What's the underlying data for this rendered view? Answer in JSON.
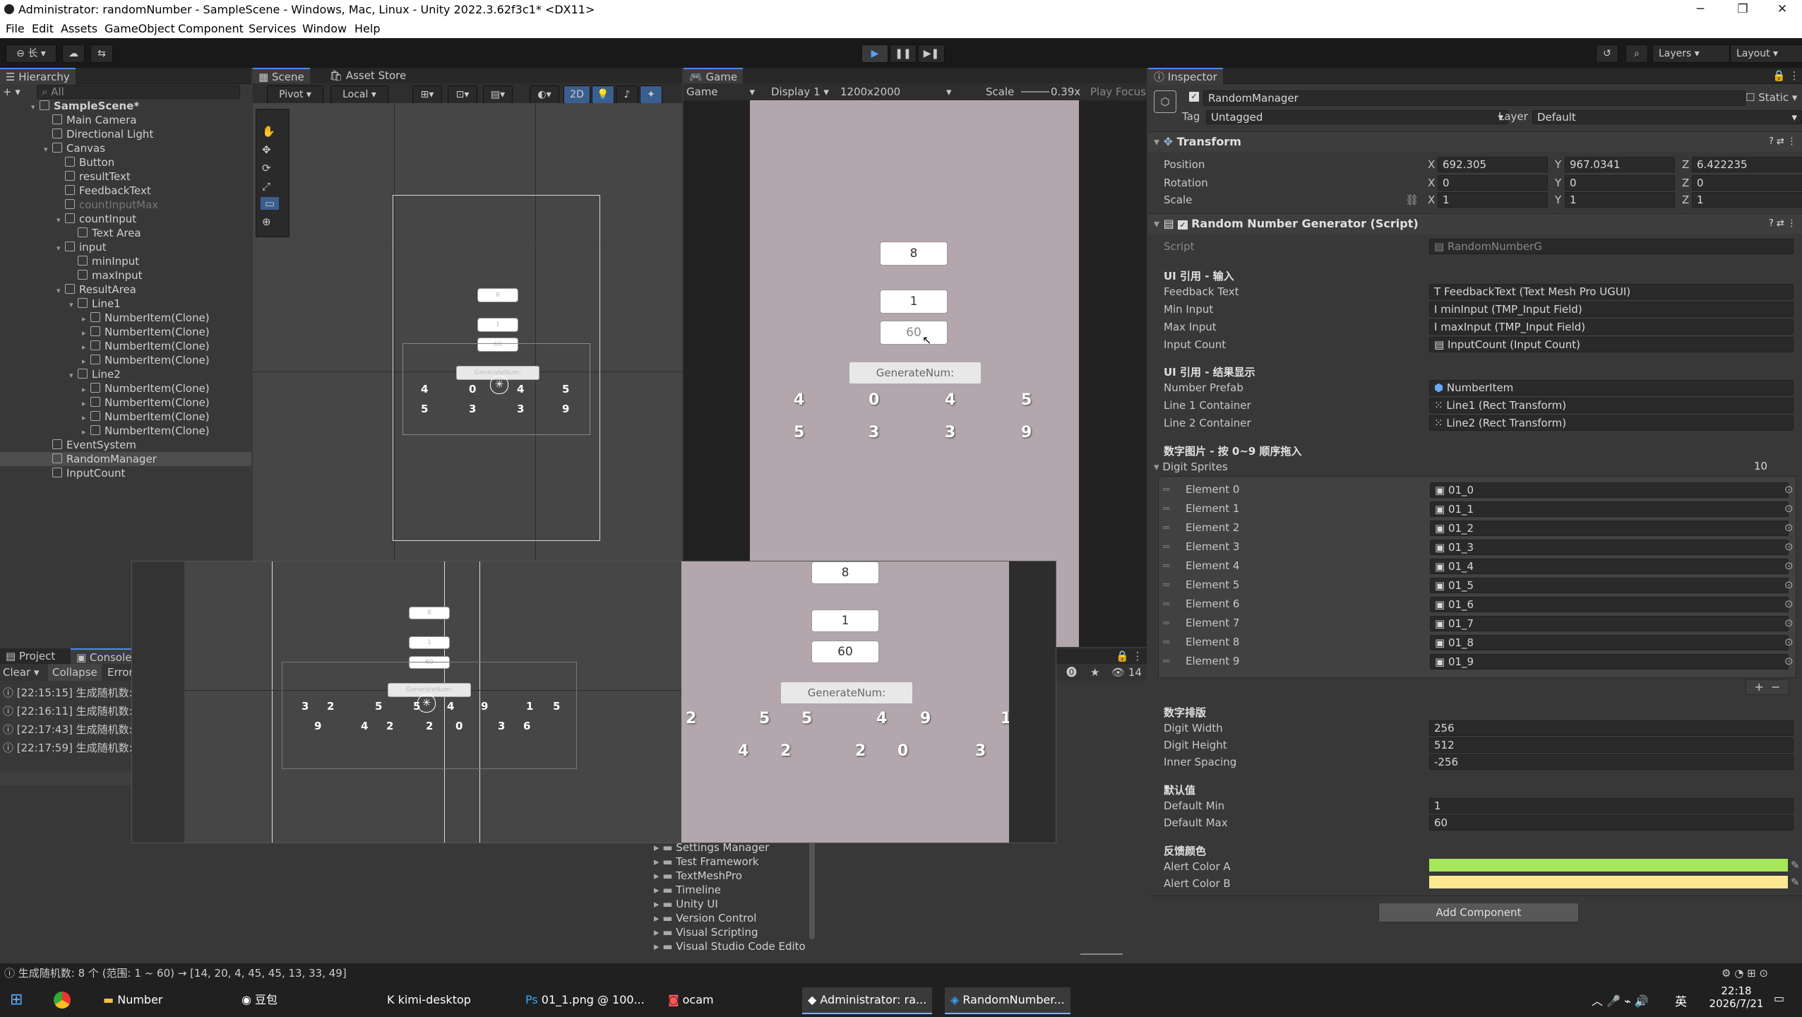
{
  "window": {
    "title": "Administrator: randomNumber - SampleScene - Windows, Mac, Linux - Unity 2022.3.62f3c1* <DX11>"
  },
  "menu": [
    "File",
    "Edit",
    "Assets",
    "GameObject",
    "Component",
    "Services",
    "Window",
    "Help"
  ],
  "toolbar": {
    "layers": "Layers",
    "layout": "Layout"
  },
  "hierarchy": {
    "tab": "Hierarchy",
    "search": "All",
    "items": [
      {
        "label": "SampleScene*",
        "depth": 0
      },
      {
        "label": "Main Camera",
        "depth": 1
      },
      {
        "label": "Directional Light",
        "depth": 1
      },
      {
        "label": "Canvas",
        "depth": 1
      },
      {
        "label": "Button",
        "depth": 2
      },
      {
        "label": "resultText",
        "depth": 2
      },
      {
        "label": "FeedbackText",
        "depth": 2
      },
      {
        "label": "countInputMax",
        "depth": 2
      },
      {
        "label": "countInput",
        "depth": 2
      },
      {
        "label": "Text Area",
        "depth": 3
      },
      {
        "label": "input",
        "depth": 2
      },
      {
        "label": "minInput",
        "depth": 3
      },
      {
        "label": "maxInput",
        "depth": 3
      },
      {
        "label": "ResultArea",
        "depth": 2
      },
      {
        "label": "Line1",
        "depth": 3
      },
      {
        "label": "NumberItem(Clone)",
        "depth": 4
      },
      {
        "label": "NumberItem(Clone)",
        "depth": 4
      },
      {
        "label": "NumberItem(Clone)",
        "depth": 4
      },
      {
        "label": "NumberItem(Clone)",
        "depth": 4
      },
      {
        "label": "Line2",
        "depth": 3
      },
      {
        "label": "NumberItem(Clone)",
        "depth": 4
      },
      {
        "label": "NumberItem(Clone)",
        "depth": 4
      },
      {
        "label": "NumberItem(Clone)",
        "depth": 4
      },
      {
        "label": "NumberItem(Clone)",
        "depth": 4
      },
      {
        "label": "EventSystem",
        "depth": 1
      },
      {
        "label": "RandomManager",
        "depth": 1
      },
      {
        "label": "InputCount",
        "depth": 1
      }
    ]
  },
  "scene": {
    "tab1": "Scene",
    "tab2": "Asset Store",
    "pivot": "Pivot",
    "local": "Local",
    "mode2d": "2D",
    "labels": [
      "8",
      "1",
      "60",
      "GenerateNum:"
    ],
    "row1": [
      "4",
      "0",
      "4",
      "5"
    ],
    "row2": [
      "5",
      "3",
      "3",
      "9"
    ]
  },
  "game": {
    "tab": "Game",
    "mode": "Game",
    "display": "Display 1",
    "res": "1200x2000",
    "scale_label": "Scale",
    "scale": "0.39x",
    "play": "Play Focus",
    "count": "8",
    "min": "1",
    "max": "60",
    "button": "GenerateNum:",
    "row1": [
      "4",
      "0",
      "4",
      "5"
    ],
    "row2": [
      "5",
      "3",
      "3",
      "9"
    ]
  },
  "overlay": {
    "scene": {
      "labels": [
        "8",
        "1",
        "60",
        "GenerateNum:"
      ],
      "row1": [
        "3",
        "2",
        "5",
        "5",
        "4",
        "9",
        "1",
        "5"
      ],
      "row2": [
        "9",
        "4",
        "2",
        "2",
        "0",
        "3",
        "6"
      ]
    },
    "game": {
      "count": "8",
      "min": "1",
      "max": "60",
      "button": "GenerateNum:",
      "row1": [
        "2",
        "5",
        "5",
        "4",
        "9",
        "1"
      ],
      "row2": [
        "4",
        "2",
        "2",
        "0",
        "3"
      ]
    }
  },
  "project": {
    "tab1": "Project",
    "tab2": "Console",
    "clear": "Clear",
    "collapse": "Collapse",
    "error": "Error",
    "count": "14",
    "logs": [
      "[22:15:15] 生成随机数:",
      "[22:16:11] 生成随机数:",
      "[22:17:43] 生成随机数:",
      "[22:17:59] 生成随机数:"
    ],
    "packages": [
      "Settings Manager",
      "Test Framework",
      "TextMeshPro",
      "Timeline",
      "Unity UI",
      "Version Control",
      "Visual Scripting",
      "Visual Studio Code Edito"
    ]
  },
  "inspector": {
    "tab": "Inspector",
    "object": "RandomManager",
    "static": "Static",
    "tag_label": "Tag",
    "tag": "Untagged",
    "layer_label": "Layer",
    "layer": "Default",
    "transform": {
      "title": "Transform",
      "position": {
        "label": "Position",
        "x": "692.305",
        "y": "967.0341",
        "z": "6.422235"
      },
      "rotation": {
        "label": "Rotation",
        "x": "0",
        "y": "0",
        "z": "0"
      },
      "scale": {
        "label": "Scale",
        "x": "1",
        "y": "1",
        "z": "1"
      }
    },
    "script": {
      "title": "Random Number Generator (Script)",
      "script_label": "Script",
      "script": "RandomNumberG",
      "sec_input": "UI 引用 - 输入",
      "feedback_label": "Feedback Text",
      "feedback": "FeedbackText (Text Mesh Pro UGUI)",
      "min_label": "Min Input",
      "min": "minInput (TMP_Input Field)",
      "max_label": "Max Input",
      "max": "maxInput (TMP_Input Field)",
      "count_label": "Input Count",
      "count": "InputCount (Input Count)",
      "sec_result": "UI 引用 - 结果显示",
      "prefab_label": "Number Prefab",
      "prefab": "NumberItem",
      "line1_label": "Line 1 Container",
      "line1": "Line1 (Rect Transform)",
      "line2_label": "Line 2 Container",
      "line2": "Line2 (Rect Transform)",
      "sec_sprites": "数字图片 - 按 0~9 顺序拖入",
      "sprites_label": "Digit Sprites",
      "sprites_count": "10",
      "elements": [
        {
          "label": "Element 0",
          "value": "01_0"
        },
        {
          "label": "Element 1",
          "value": "01_1"
        },
        {
          "label": "Element 2",
          "value": "01_2"
        },
        {
          "label": "Element 3",
          "value": "01_3"
        },
        {
          "label": "Element 4",
          "value": "01_4"
        },
        {
          "label": "Element 5",
          "value": "01_5"
        },
        {
          "label": "Element 6",
          "value": "01_6"
        },
        {
          "label": "Element 7",
          "value": "01_7"
        },
        {
          "label": "Element 8",
          "value": "01_8"
        },
        {
          "label": "Element 9",
          "value": "01_9"
        }
      ],
      "sec_layout": "数字排版",
      "dw_label": "Digit Width",
      "dw": "256",
      "dh_label": "Digit Height",
      "dh": "512",
      "is_label": "Inner Spacing",
      "is": "-256",
      "sec_default": "默认值",
      "dmin_label": "Default Min",
      "dmin": "1",
      "dmax_label": "Default Max",
      "dmax": "60",
      "sec_color": "反馈颜色",
      "ca_label": "Alert Color A",
      "ca": "#a6e85a",
      "cb_label": "Alert Color B",
      "cb": "#fbe890"
    },
    "add_component": "Add Component"
  },
  "status": {
    "text": "生成随机数: 8 个 (范围: 1 ~ 60) → [14, 20, 4, 45, 45, 13, 33, 49]"
  },
  "taskbar": {
    "apps": [
      "Number",
      "豆包",
      "kimi-desktop",
      "01_1.png @ 100...",
      "ocam",
      "Administrator: ra...",
      "RandomNumber..."
    ],
    "time": "22:18",
    "date": "2026/7/21",
    "ime": "英"
  }
}
